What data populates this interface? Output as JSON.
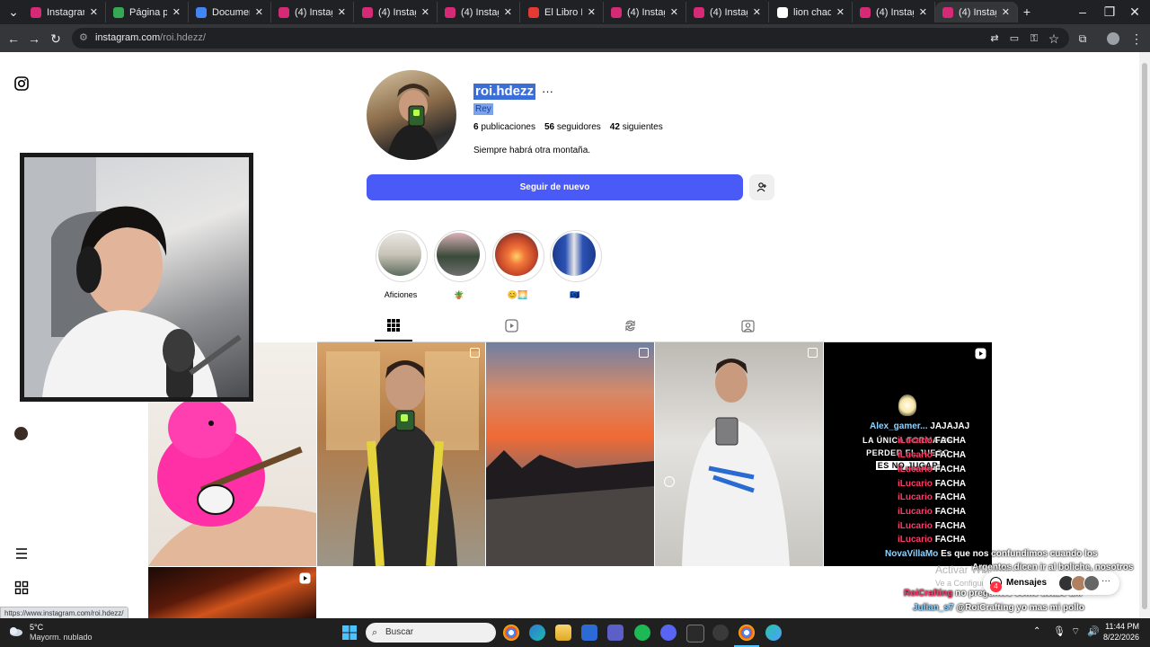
{
  "browser": {
    "tabs": [
      {
        "title": "Instagram",
        "favicon": "instagram-icon"
      },
      {
        "title": "Página principal",
        "favicon": "drive-icon"
      },
      {
        "title": "Documento",
        "favicon": "docs-icon"
      },
      {
        "title": "(4) Instagram",
        "favicon": "instagram-icon"
      },
      {
        "title": "(4) Instagram",
        "favicon": "instagram-icon"
      },
      {
        "title": "(4) Instagram",
        "favicon": "instagram-icon"
      },
      {
        "title": "El Libro De L",
        "favicon": "book-icon"
      },
      {
        "title": "(4) Instagram",
        "favicon": "instagram-icon"
      },
      {
        "title": "(4) Instagram",
        "favicon": "instagram-icon"
      },
      {
        "title": "lion chaquet",
        "favicon": "google-icon"
      },
      {
        "title": "(4) Instagram",
        "favicon": "instagram-icon"
      },
      {
        "title": "(4) Instagram",
        "favicon": "instagram-icon"
      }
    ],
    "url_host": "instagram.com",
    "url_path": "/roi.hdezz/",
    "status_link": "https://www.instagram.com/roi.hdezz/"
  },
  "profile": {
    "username": "roi.hdezz",
    "more": "···",
    "full_name": "Rey",
    "posts_count": "6",
    "posts_label": "publicaciones",
    "followers_count": "56",
    "followers_label": "seguidores",
    "following_count": "42",
    "following_label": "siguientes",
    "bio": "Siempre habrá otra montaña.",
    "follow_button": "Seguir de nuevo"
  },
  "highlights": [
    {
      "label": "Aficiones"
    },
    {
      "label": "🪴"
    },
    {
      "label": "😊🌅"
    },
    {
      "label": "🇪🇺"
    }
  ],
  "chat": [
    {
      "user": "Alex_gamer...",
      "text": "JAJAJAJ"
    },
    {
      "user": "iLucario",
      "text": "FACHA"
    },
    {
      "user": "iLucario",
      "text": "FACHA"
    },
    {
      "user": "iLucario",
      "text": "FACHA"
    },
    {
      "user": "iLucario",
      "text": "FACHA"
    },
    {
      "user": "iLucario",
      "text": "FACHA"
    },
    {
      "user": "iLucario",
      "text": "FACHA"
    },
    {
      "user": "iLucario",
      "text": "FACHA"
    },
    {
      "user": "iLucario",
      "text": "FACHA"
    },
    {
      "user": "NovaVillaMo",
      "text": "Es que nos confundimos cuando los"
    },
    {
      "user": "",
      "text": "Argentos dicen ir al boliche, nosotros"
    },
    {
      "user": "RoiCrafting",
      "text": "no preguntes como acabe ahi"
    },
    {
      "user": "Julian_s7",
      "text": "@RoiCrafting yo mas mi pollo"
    }
  ],
  "post_text": {
    "line1": "LA ÚNICA FORMA DE",
    "line2": "PERDER EL JUEGO",
    "line3": "ES NO JUGAR"
  },
  "messages_label": "Mensajes",
  "messages_badge": "4",
  "activate_windows": "Activar Windows",
  "activate_sub": "Ve a Configuración para activar Windows.",
  "taskbar": {
    "weather_temp": "5°C",
    "weather_desc": "Mayorm. nublado",
    "search_placeholder": "Buscar",
    "time": "11:44 PM",
    "date": "8/22/2026"
  }
}
